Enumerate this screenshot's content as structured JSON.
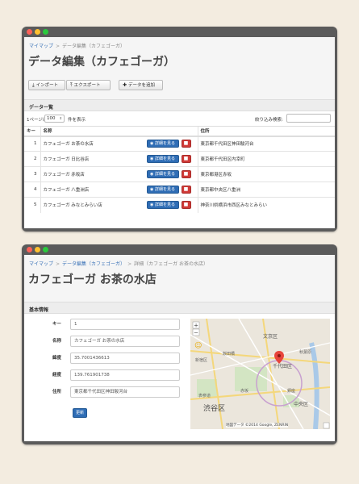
{
  "list_window": {
    "breadcrumb": [
      "マイマップ",
      "データ編集（カフェゴーガ）"
    ],
    "title": "データ編集（カフェゴーガ）",
    "toolbar": {
      "import_label": "インポート",
      "export_label": "エクスポート",
      "add_label": "データを追加"
    },
    "panel_title": "データ一覧",
    "per_page_prefix": "1ページに",
    "per_page_value": "100",
    "per_page_suffix": "件を表示",
    "filter_label": "絞り込み検索:",
    "filter_value": "",
    "columns": [
      "キー",
      "名称",
      "住所"
    ],
    "detail_label": "詳細を見る",
    "rows": [
      {
        "key": "1",
        "name": "カフェゴーガ お茶の水店",
        "address": "東京都千代田区神田駿河台"
      },
      {
        "key": "2",
        "name": "カフェゴーガ 日比谷店",
        "address": "東京都千代田区内幸町"
      },
      {
        "key": "3",
        "name": "カフェゴーガ 赤坂店",
        "address": "東京都港区赤坂"
      },
      {
        "key": "4",
        "name": "カフェゴーガ 八重洲店",
        "address": "東京都中央区八重洲"
      },
      {
        "key": "5",
        "name": "カフェゴーガ みなとみらい店",
        "address": "神奈川県横浜市西区みなとみらい"
      }
    ]
  },
  "detail_window": {
    "breadcrumb": [
      "マイマップ",
      "データ編集（カフェゴーガ）",
      "詳細（カフェゴーガ お茶の水店）"
    ],
    "title": "カフェゴーガ お茶の水店",
    "panel_title": "基本情報",
    "fields": [
      {
        "label": "キー",
        "value": "1"
      },
      {
        "label": "名称",
        "value": "カフェゴーガ お茶の水店"
      },
      {
        "label": "緯度",
        "value": "35.7001436613"
      },
      {
        "label": "経度",
        "value": "139.761901738"
      },
      {
        "label": "住所",
        "value": "東京都千代田区神田駿河台"
      }
    ],
    "update_label": "更新",
    "map": {
      "labels": [
        "文京区",
        "千代田区",
        "中央区",
        "渋谷区",
        "飯田橋",
        "秋葉原",
        "新宿区",
        "赤坂",
        "表参道",
        "銀座"
      ],
      "copyright": "地図データ ©2014 Google, ZENRIN"
    }
  },
  "colors": {
    "link": "#3a72b7",
    "primary_button": "#2f6db5",
    "danger_button": "#d03a37",
    "window_frame": "#5b5b5b",
    "background": "#f3ece0"
  }
}
